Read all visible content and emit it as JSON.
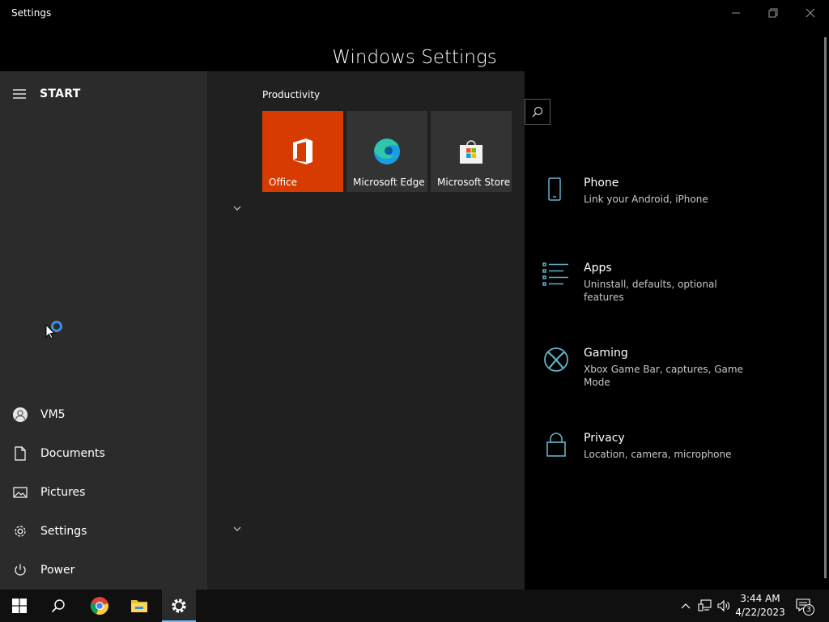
{
  "window": {
    "title": "Settings",
    "heading": "Windows Settings"
  },
  "categories": [
    {
      "title": "Phone",
      "desc": "Link your Android, iPhone",
      "icon": "phone-icon"
    },
    {
      "title": "Apps",
      "desc": "Uninstall, defaults, optional features",
      "icon": "apps-list-icon"
    },
    {
      "title": "Gaming",
      "desc": "Xbox Game Bar, captures, Game Mode",
      "icon": "xbox-icon"
    },
    {
      "title": "Privacy",
      "desc": "Location, camera, microphone",
      "icon": "lock-icon"
    }
  ],
  "start_menu": {
    "header": "START",
    "user": "VM5",
    "documents": "Documents",
    "pictures": "Pictures",
    "settings": "Settings",
    "power": "Power",
    "group_label": "Productivity",
    "tiles": [
      {
        "label": "Office",
        "icon": "office-icon",
        "bg": "#d83b01"
      },
      {
        "label": "Microsoft Edge",
        "icon": "edge-icon",
        "bg": "#333333"
      },
      {
        "label": "Microsoft Store",
        "icon": "store-icon",
        "bg": "#333333"
      }
    ]
  },
  "taskbar": {
    "time": "3:44 AM",
    "date": "4/22/2023",
    "notification_count": "3"
  },
  "colors": {
    "accent": "#76b9ed",
    "settings_icon": "#5fb3c8",
    "office": "#d83b01"
  }
}
